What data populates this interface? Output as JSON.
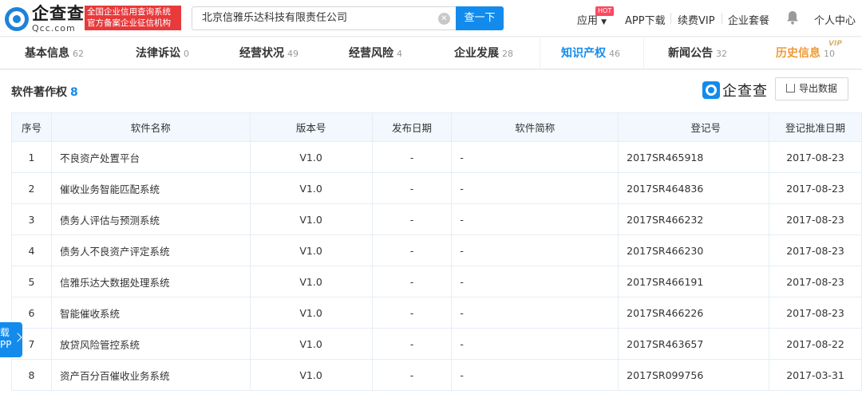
{
  "header": {
    "logo_cn": "企查查",
    "logo_en": "Qcc.com",
    "badge_line1": "全国企业信用查询系统",
    "badge_line2": "官方备案企业征信机构",
    "search_value": "北京信雅乐达科技有限责任公司",
    "search_button": "查一下",
    "nav": {
      "apply": "应用",
      "hot": "HOT",
      "app_download": "APP下载",
      "vip_renew": "续费VIP",
      "enterprise_package": "企业套餐",
      "personal_center": "个人中心"
    }
  },
  "tabs": [
    {
      "label": "基本信息",
      "count": "62"
    },
    {
      "label": "法律诉讼",
      "count": "0"
    },
    {
      "label": "经营状况",
      "count": "49"
    },
    {
      "label": "经营风险",
      "count": "4"
    },
    {
      "label": "企业发展",
      "count": "28"
    },
    {
      "label": "知识产权",
      "count": "46"
    },
    {
      "label": "新闻公告",
      "count": "32"
    },
    {
      "label": "历史信息",
      "count": "10"
    }
  ],
  "vip_tag": "VIP",
  "section": {
    "title": "软件著作权",
    "count": "8",
    "brand": "企查查",
    "export": "导出数据"
  },
  "table": {
    "headers": [
      "序号",
      "软件名称",
      "版本号",
      "发布日期",
      "软件简称",
      "登记号",
      "登记批准日期"
    ],
    "rows": [
      [
        "1",
        "不良资产处置平台",
        "V1.0",
        "-",
        "-",
        "2017SR465918",
        "2017-08-23"
      ],
      [
        "2",
        "催收业务智能匹配系统",
        "V1.0",
        "-",
        "-",
        "2017SR464836",
        "2017-08-23"
      ],
      [
        "3",
        "债务人评估与预测系统",
        "V1.0",
        "-",
        "-",
        "2017SR466232",
        "2017-08-23"
      ],
      [
        "4",
        "债务人不良资产评定系统",
        "V1.0",
        "-",
        "-",
        "2017SR466230",
        "2017-08-23"
      ],
      [
        "5",
        "信雅乐达大数据处理系统",
        "V1.0",
        "-",
        "-",
        "2017SR466191",
        "2017-08-23"
      ],
      [
        "6",
        "智能催收系统",
        "V1.0",
        "-",
        "-",
        "2017SR466226",
        "2017-08-23"
      ],
      [
        "7",
        "放贷风险管控系统",
        "V1.0",
        "-",
        "-",
        "2017SR463657",
        "2017-08-22"
      ],
      [
        "8",
        "资产百分百催收业务系统",
        "V1.0",
        "-",
        "-",
        "2017SR099756",
        "2017-03-31"
      ]
    ]
  },
  "side_float": {
    "line1": "载",
    "line2": "PP"
  },
  "colors": {
    "accent": "#128bed",
    "badge_red": "#e8393b",
    "history_orange": "#f09a35"
  }
}
